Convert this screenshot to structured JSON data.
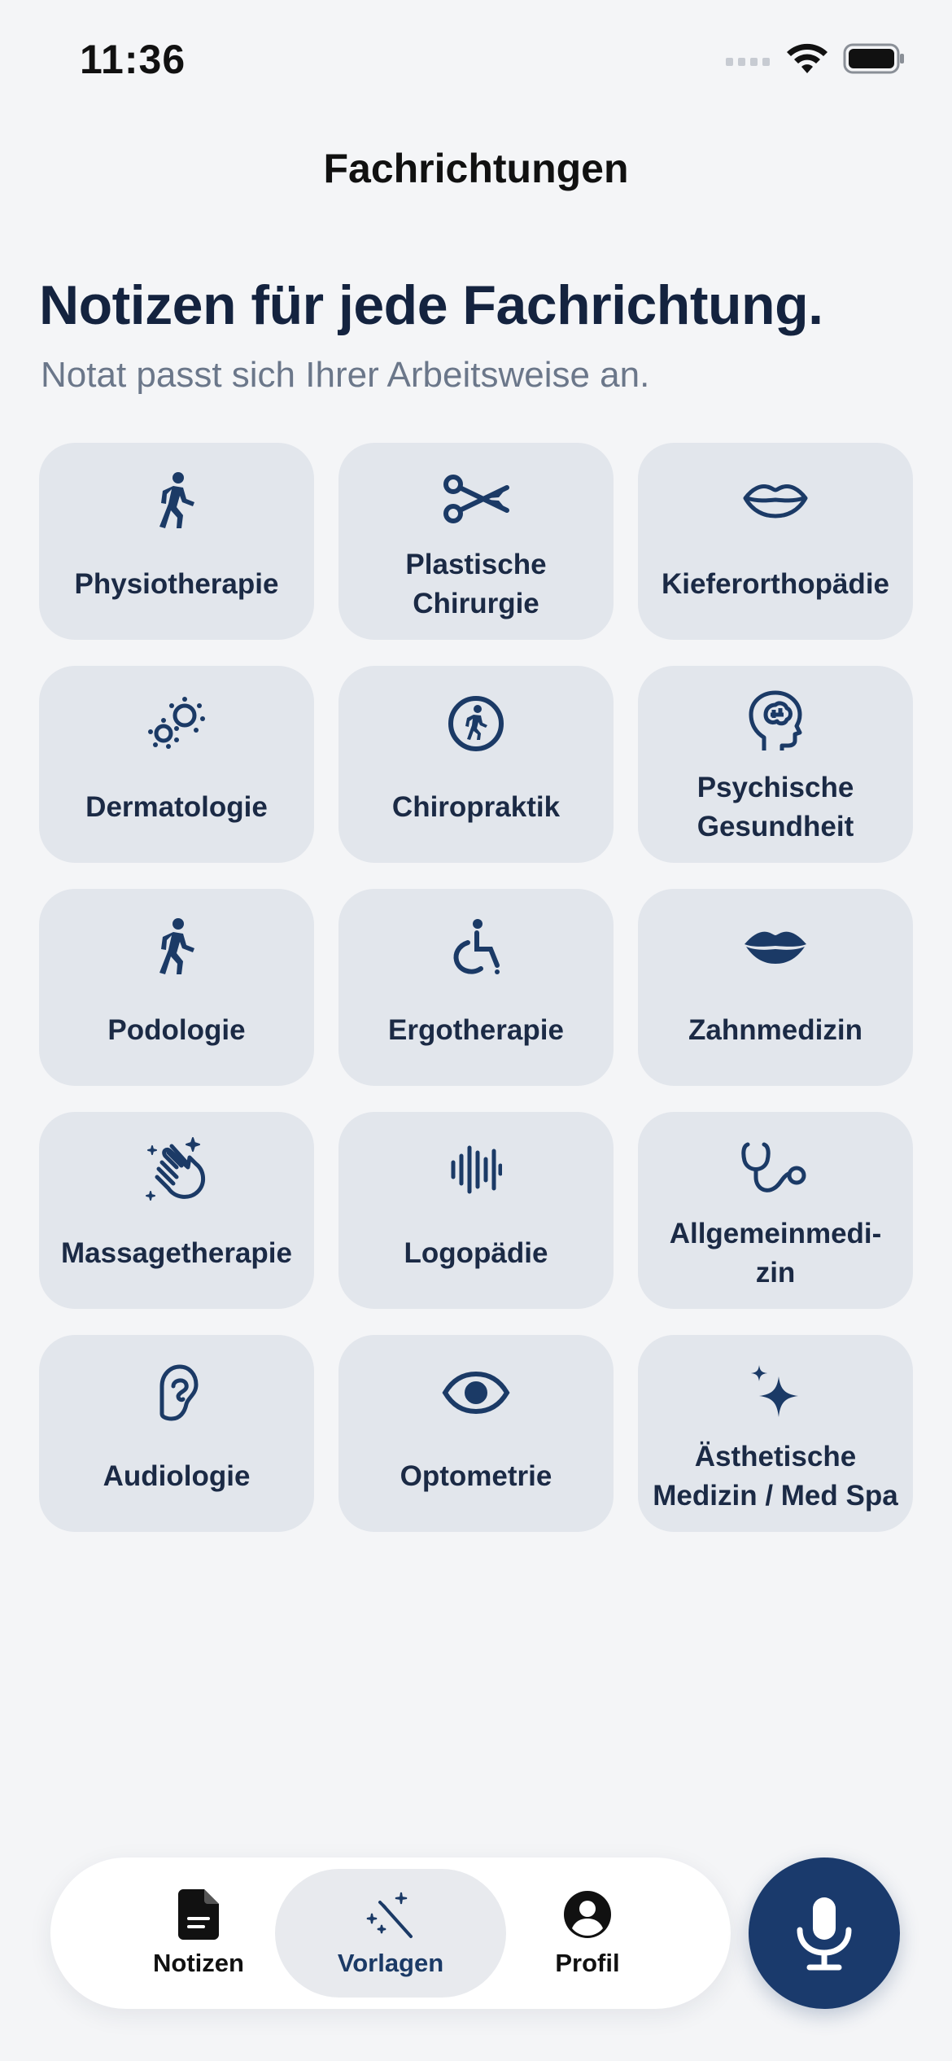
{
  "status_bar": {
    "time": "11:36"
  },
  "nav": {
    "title": "Fachrichtungen"
  },
  "header": {
    "headline": "Notizen für jede Fachrichtung.",
    "subline": "Notat passt sich Ihrer Arbeitsweise an."
  },
  "specialties": [
    {
      "label": "Physiotherapie",
      "icon": "walking-person-icon"
    },
    {
      "label": "Plastische\nChirurgie",
      "icon": "scissors-icon"
    },
    {
      "label": "Kieferorthopädie",
      "icon": "lips-outline-icon"
    },
    {
      "label": "Dermatologie",
      "icon": "microbes-icon"
    },
    {
      "label": "Chiropraktik",
      "icon": "walking-circle-icon"
    },
    {
      "label": "Psychische\nGesundheit",
      "icon": "brain-head-icon"
    },
    {
      "label": "Podologie",
      "icon": "walking-person-icon"
    },
    {
      "label": "Ergotherapie",
      "icon": "wheelchair-icon"
    },
    {
      "label": "Zahnmedizin",
      "icon": "lips-filled-icon"
    },
    {
      "label": "Massagetherapie",
      "icon": "hands-sparkles-icon"
    },
    {
      "label": "Logopädie",
      "icon": "waveform-icon"
    },
    {
      "label": "Allgemeinmedi-\nzin",
      "icon": "stethoscope-icon"
    },
    {
      "label": "Audiologie",
      "icon": "ear-icon"
    },
    {
      "label": "Optometrie",
      "icon": "eye-icon"
    },
    {
      "label": "Ästhetische\nMedizin / Med Spa",
      "icon": "sparkles-icon"
    }
  ],
  "tabbar": {
    "tabs": [
      {
        "label": "Notizen",
        "icon": "document-icon"
      },
      {
        "label": "Vorlagen",
        "icon": "magic-wand-icon",
        "active": true
      },
      {
        "label": "Profil",
        "icon": "profile-icon"
      }
    ],
    "mic": {
      "icon": "microphone-icon"
    }
  },
  "colors": {
    "accent": "#1a3a6c",
    "card": "#e2e6ec",
    "background": "#f4f5f7"
  }
}
